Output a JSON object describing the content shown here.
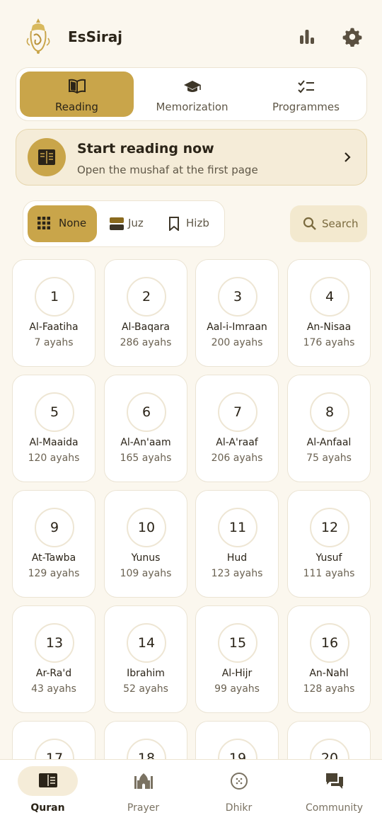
{
  "app": {
    "title": "EsSiraj"
  },
  "header": {
    "stats_icon": "bar-chart-icon",
    "settings_icon": "gear-icon"
  },
  "mode_tabs": [
    {
      "label": "Reading",
      "icon": "open-book-icon",
      "active": true
    },
    {
      "label": "Memorization",
      "icon": "graduation-cap-icon",
      "active": false
    },
    {
      "label": "Programmes",
      "icon": "checklist-icon",
      "active": false
    }
  ],
  "start_card": {
    "title": "Start reading now",
    "subtitle": "Open the mushaf at the first page",
    "icon": "mushaf-icon",
    "chevron": "chevron-right-icon"
  },
  "grouping": [
    {
      "label": "None",
      "icon": "grid-icon",
      "active": true
    },
    {
      "label": "Juz",
      "icon": "juz-icon",
      "active": false
    },
    {
      "label": "Hizb",
      "icon": "bookmark-icon",
      "active": false
    }
  ],
  "search": {
    "label": "Search",
    "icon": "search-icon"
  },
  "surahs": [
    {
      "number": "1",
      "name": "Al-Faatiha",
      "ayahs": "7 ayahs"
    },
    {
      "number": "2",
      "name": "Al-Baqara",
      "ayahs": "286 ayahs"
    },
    {
      "number": "3",
      "name": "Aal-i-Imraan",
      "ayahs": "200 ayahs"
    },
    {
      "number": "4",
      "name": "An-Nisaa",
      "ayahs": "176 ayahs"
    },
    {
      "number": "5",
      "name": "Al-Maaida",
      "ayahs": "120 ayahs"
    },
    {
      "number": "6",
      "name": "Al-An'aam",
      "ayahs": "165 ayahs"
    },
    {
      "number": "7",
      "name": "Al-A'raaf",
      "ayahs": "206 ayahs"
    },
    {
      "number": "8",
      "name": "Al-Anfaal",
      "ayahs": "75 ayahs"
    },
    {
      "number": "9",
      "name": "At-Tawba",
      "ayahs": "129 ayahs"
    },
    {
      "number": "10",
      "name": "Yunus",
      "ayahs": "109 ayahs"
    },
    {
      "number": "11",
      "name": "Hud",
      "ayahs": "123 ayahs"
    },
    {
      "number": "12",
      "name": "Yusuf",
      "ayahs": "111 ayahs"
    },
    {
      "number": "13",
      "name": "Ar-Ra'd",
      "ayahs": "43 ayahs"
    },
    {
      "number": "14",
      "name": "Ibrahim",
      "ayahs": "52 ayahs"
    },
    {
      "number": "15",
      "name": "Al-Hijr",
      "ayahs": "99 ayahs"
    },
    {
      "number": "16",
      "name": "An-Nahl",
      "ayahs": "128 ayahs"
    },
    {
      "number": "17",
      "name": "",
      "ayahs": ""
    },
    {
      "number": "18",
      "name": "",
      "ayahs": ""
    },
    {
      "number": "19",
      "name": "",
      "ayahs": ""
    },
    {
      "number": "20",
      "name": "",
      "ayahs": ""
    }
  ],
  "bottom_nav": [
    {
      "label": "Quran",
      "icon": "quran-book-icon",
      "active": true
    },
    {
      "label": "Prayer",
      "icon": "mosque-icon",
      "active": false
    },
    {
      "label": "Dhikr",
      "icon": "prayer-beads-icon",
      "active": false
    },
    {
      "label": "Community",
      "icon": "chat-bubbles-icon",
      "active": false
    }
  ],
  "colors": {
    "accent": "#c9a54a",
    "background": "#fbf7ee",
    "text": "#2b2418",
    "muted": "#6b6252"
  }
}
